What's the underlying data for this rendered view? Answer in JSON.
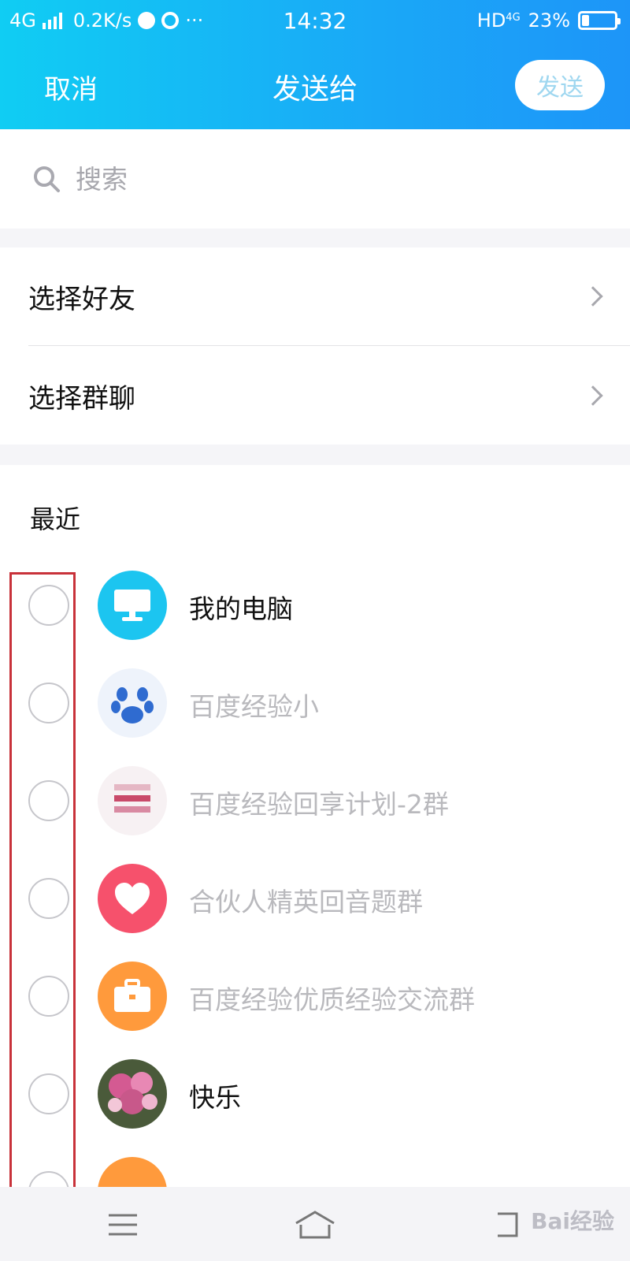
{
  "status_bar": {
    "network": "4G",
    "speed": "0.2K/s",
    "more": "···",
    "time": "14:32",
    "hd": "HD",
    "hd_sup": "4G",
    "battery": "23%",
    "battery_level": 0.23
  },
  "header": {
    "cancel_label": "取消",
    "title": "发送给",
    "send_label": "发送"
  },
  "search": {
    "placeholder": "搜索",
    "value": ""
  },
  "menu": {
    "items": [
      {
        "label": "选择好友",
        "icon": "chevron-right-icon"
      },
      {
        "label": "选择群聊",
        "icon": "chevron-right-icon"
      }
    ]
  },
  "recent": {
    "title": "最近",
    "contacts": [
      {
        "name": "我的电脑",
        "avatar": "computer-icon",
        "color": "#1cc5f0"
      },
      {
        "name": "百度经验小",
        "avatar": "paw-logo",
        "color": "#2f6bd0"
      },
      {
        "name": "百度经验回享计划-2群",
        "avatar": "group-photo",
        "color": "#c94a6a"
      },
      {
        "name": "合伙人精英回音题群",
        "avatar": "heart-icon",
        "color": "#f6516c"
      },
      {
        "name": "百度经验优质经验交流群",
        "avatar": "briefcase-icon",
        "color": "#ff9a3c"
      },
      {
        "name": "快乐",
        "avatar": "flower-photo",
        "color": "#c8588a"
      },
      {
        "name": "",
        "avatar": "partial-avatar",
        "color": "#ff9a3c"
      }
    ]
  },
  "bottom_nav": {
    "items": [
      "menu-icon",
      "home-icon",
      "back-icon"
    ]
  },
  "watermark": "Bai经验"
}
